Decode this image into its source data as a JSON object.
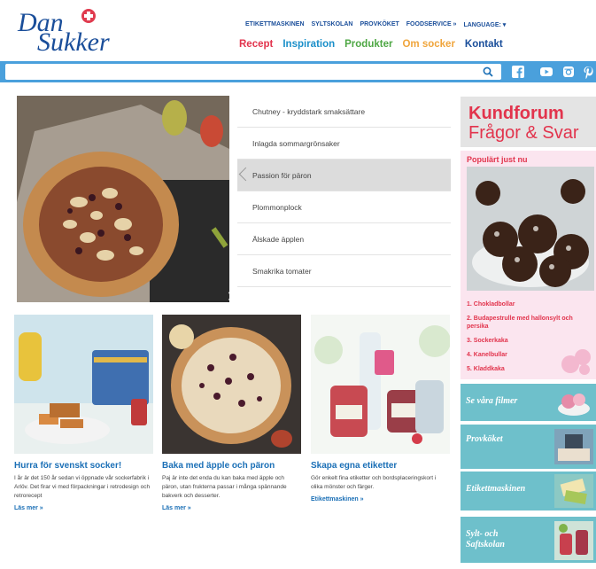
{
  "brand": {
    "line1": "Dan",
    "line2": "Sukker"
  },
  "topnav": [
    "ETIKETTMASKINEN",
    "SYLTSKOLAN",
    "PROVKÖKET",
    "FOODSERVICE »",
    "LANGUAGE: ▾"
  ],
  "mainnav": [
    {
      "label": "Recept",
      "color": "#e2344d"
    },
    {
      "label": "Inspiration",
      "color": "#1a8fc9"
    },
    {
      "label": "Produkter",
      "color": "#4ea744"
    },
    {
      "label": "Om socker",
      "color": "#f0a53c"
    },
    {
      "label": "Kontakt",
      "color": "#1a4e9a"
    }
  ],
  "search": {
    "value": "",
    "icon": "search-icon"
  },
  "social": [
    "facebook-icon",
    "youtube-icon",
    "instagram-icon",
    "pinterest-icon"
  ],
  "hero_list": [
    "Chutney - kryddstark smaksättare",
    "Inlagda sommargrönsaker",
    "Passion för päron",
    "Plommonplock",
    "Älskade äpplen",
    "Smakrika tomater"
  ],
  "hero_active_index": 2,
  "cards": [
    {
      "title": "Hurra för svenskt socker!",
      "text": "I år är det 150 år sedan vi öppnade vår sockerfabrik i Arlöv. Det firar vi med förpackningar i retrodesign och retrorecept",
      "more": "Läs mer »"
    },
    {
      "title": "Baka med äpple och päron",
      "text": "Paj är inte det enda du kan baka med äpple och päron, utan frukterna passar i många spännande bakverk och desserter.",
      "more": "Läs mer »"
    },
    {
      "title": "Skapa egna etiketter",
      "text": "Gör enkelt fina etiketter och bordsplaceringskort i olika mönster och färger.",
      "more": "Etikettmaskinen »"
    }
  ],
  "sidebar": {
    "forum_line1": "Kundforum",
    "forum_line2": "Frågor & Svar",
    "popular_title": "Populärt just nu",
    "popular": [
      "1. Chokladbollar",
      "2. Budapestrulle med hallonsylt och persika",
      "3. Sockerkaka",
      "4. Kanelbullar",
      "5. Kladdkaka"
    ],
    "tiles": [
      "Se våra filmer",
      "Provköket",
      "Etikettmaskinen",
      "Sylt- och Saftskolan"
    ]
  }
}
